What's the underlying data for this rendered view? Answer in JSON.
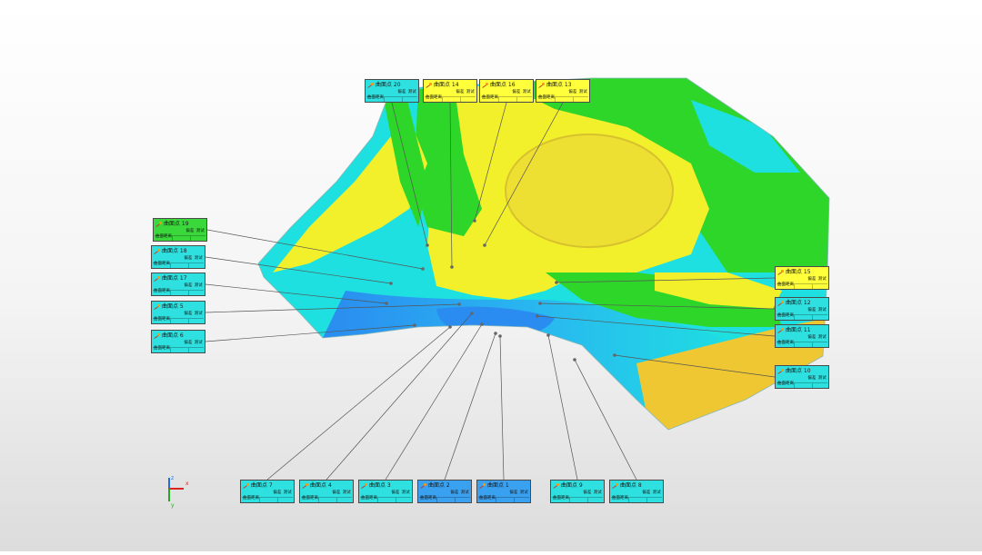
{
  "viewer": {
    "label_template": {
      "col_deviation": "偏差",
      "col_test": "测试",
      "value_label": "曲面距离"
    },
    "annotations": [
      {
        "id": "20",
        "title": "曲面点 20",
        "color": "#2fe0e0"
      },
      {
        "id": "14",
        "title": "曲面点 14",
        "color": "#ffff3c"
      },
      {
        "id": "16",
        "title": "曲面点 16",
        "color": "#ffff3c"
      },
      {
        "id": "13",
        "title": "曲面点 13",
        "color": "#ffff3c"
      },
      {
        "id": "19",
        "title": "曲面点 19",
        "color": "#3ad83a"
      },
      {
        "id": "18",
        "title": "曲面点 18",
        "color": "#2fe0e0"
      },
      {
        "id": "17",
        "title": "曲面点 17",
        "color": "#2fe0e0"
      },
      {
        "id": "5",
        "title": "曲面点 5",
        "color": "#2fe0e0"
      },
      {
        "id": "6",
        "title": "曲面点 6",
        "color": "#2fe0e0"
      },
      {
        "id": "15",
        "title": "曲面点 15",
        "color": "#ffff3c"
      },
      {
        "id": "12",
        "title": "曲面点 12",
        "color": "#2fe0e0"
      },
      {
        "id": "11",
        "title": "曲面点 11",
        "color": "#2fe0e0"
      },
      {
        "id": "10",
        "title": "曲面点 10",
        "color": "#2fe0e0"
      },
      {
        "id": "7",
        "title": "曲面点 7",
        "color": "#2fe0e0"
      },
      {
        "id": "4",
        "title": "曲面点 4",
        "color": "#2fe0e0"
      },
      {
        "id": "3",
        "title": "曲面点 3",
        "color": "#2fe0e0"
      },
      {
        "id": "2",
        "title": "曲面点 2",
        "color": "#3aa0f0"
      },
      {
        "id": "1",
        "title": "曲面点 1",
        "color": "#3aa0f0"
      },
      {
        "id": "9",
        "title": "曲面点 9",
        "color": "#2fe0e0"
      },
      {
        "id": "8",
        "title": "曲面点 8",
        "color": "#2fe0e0"
      }
    ],
    "color_map": {
      "yellow": "#f2f02a",
      "yellow_orange": "#eec733",
      "green": "#2ed62a",
      "cyan": "#1ee0e0",
      "light_blue": "#29b7f0",
      "blue": "#2a8cf0"
    },
    "axes": {
      "x_label": "x",
      "y_label": "y",
      "z_label": "z"
    }
  }
}
